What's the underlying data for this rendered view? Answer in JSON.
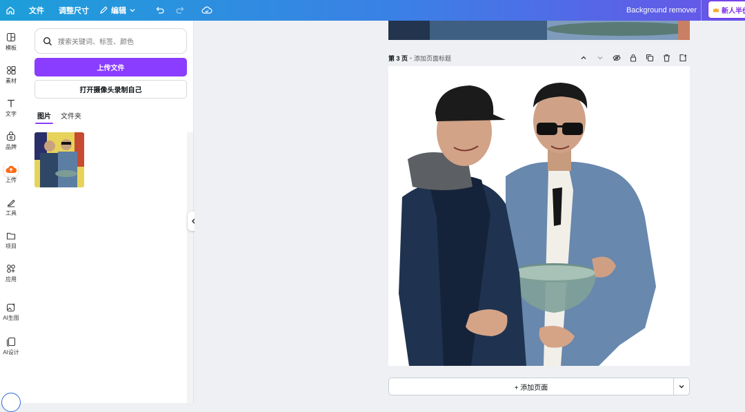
{
  "topbar": {
    "file": "文件",
    "resize": "调整尺寸",
    "edit": "编辑",
    "bg_remover": "Background remover",
    "new_user": "新人半价"
  },
  "rail": [
    {
      "label": "模板",
      "icon": "template-icon"
    },
    {
      "label": "素材",
      "icon": "elements-icon"
    },
    {
      "label": "文字",
      "icon": "text-icon"
    },
    {
      "label": "品牌",
      "icon": "brand-icon"
    },
    {
      "label": "上传",
      "icon": "upload-cloud-icon",
      "active": true
    },
    {
      "label": "工具",
      "icon": "tools-icon"
    },
    {
      "label": "项目",
      "icon": "folder-icon"
    },
    {
      "label": "应用",
      "icon": "apps-icon"
    },
    {
      "label": "AI生图",
      "icon": "ai-image-icon"
    },
    {
      "label": "AI设计",
      "icon": "ai-design-icon"
    }
  ],
  "panel": {
    "search_placeholder": "搜索关键词、标签、颜色",
    "upload_label": "上传文件",
    "camera_label": "打开摄像头录制自己",
    "tabs": [
      "图片",
      "文件夹"
    ]
  },
  "page": {
    "number": "第 3 页",
    "separator": "-",
    "title_placeholder": "添加页面标题"
  },
  "add_page_label": "+ 添加页面",
  "colors": {
    "accent": "#8b3dff",
    "topbar_start": "#1d9fd9",
    "topbar_end": "#6a53e8"
  }
}
